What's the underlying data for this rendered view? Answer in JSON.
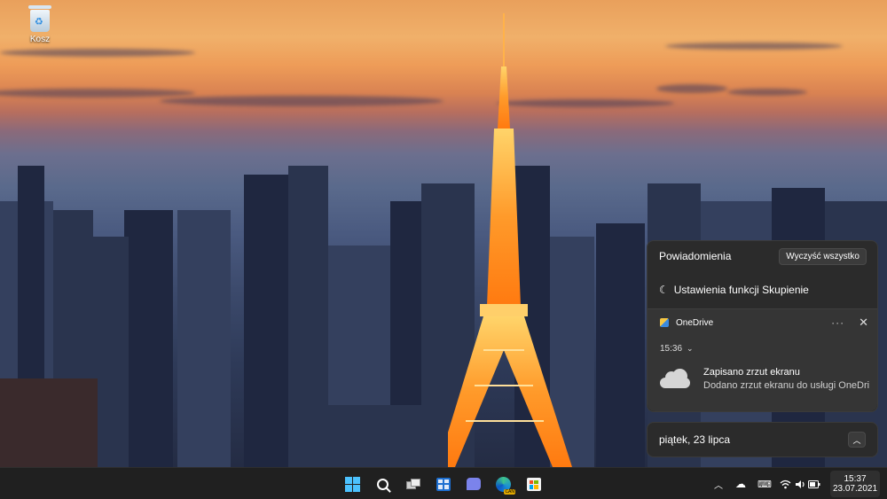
{
  "desktop": {
    "icons": [
      {
        "label": "Kosz",
        "icon": "recycle-bin-icon"
      }
    ]
  },
  "notifications": {
    "title": "Powiadomienia",
    "clear_all_label": "Wyczyść wszystko",
    "focus_settings_label": "Ustawienia funkcji Skupienie",
    "card": {
      "app_name": "OneDrive",
      "time": "15:36",
      "title": "Zapisano zrzut ekranu",
      "body": "Dodano zrzut ekranu do usługi OneDri"
    }
  },
  "calendar": {
    "date_label": "piątek, 23 lipca"
  },
  "taskbar": {
    "apps": [
      "windows-start-icon",
      "search-icon",
      "task-view-icon",
      "widgets-icon",
      "chat-icon",
      "edge-canary-icon",
      "store-icon"
    ],
    "edge_badge": "CAN",
    "tray": {
      "time": "15:37",
      "date": "23.07.2021",
      "icons": [
        "chevron-up-icon",
        "onedrive-cloud-icon",
        "keyboard-icon",
        "wifi-icon",
        "volume-icon",
        "battery-icon"
      ]
    }
  },
  "colors": {
    "accent": "#4cc2ff",
    "panel": "#2b2b2b",
    "taskbar": "#202020"
  }
}
